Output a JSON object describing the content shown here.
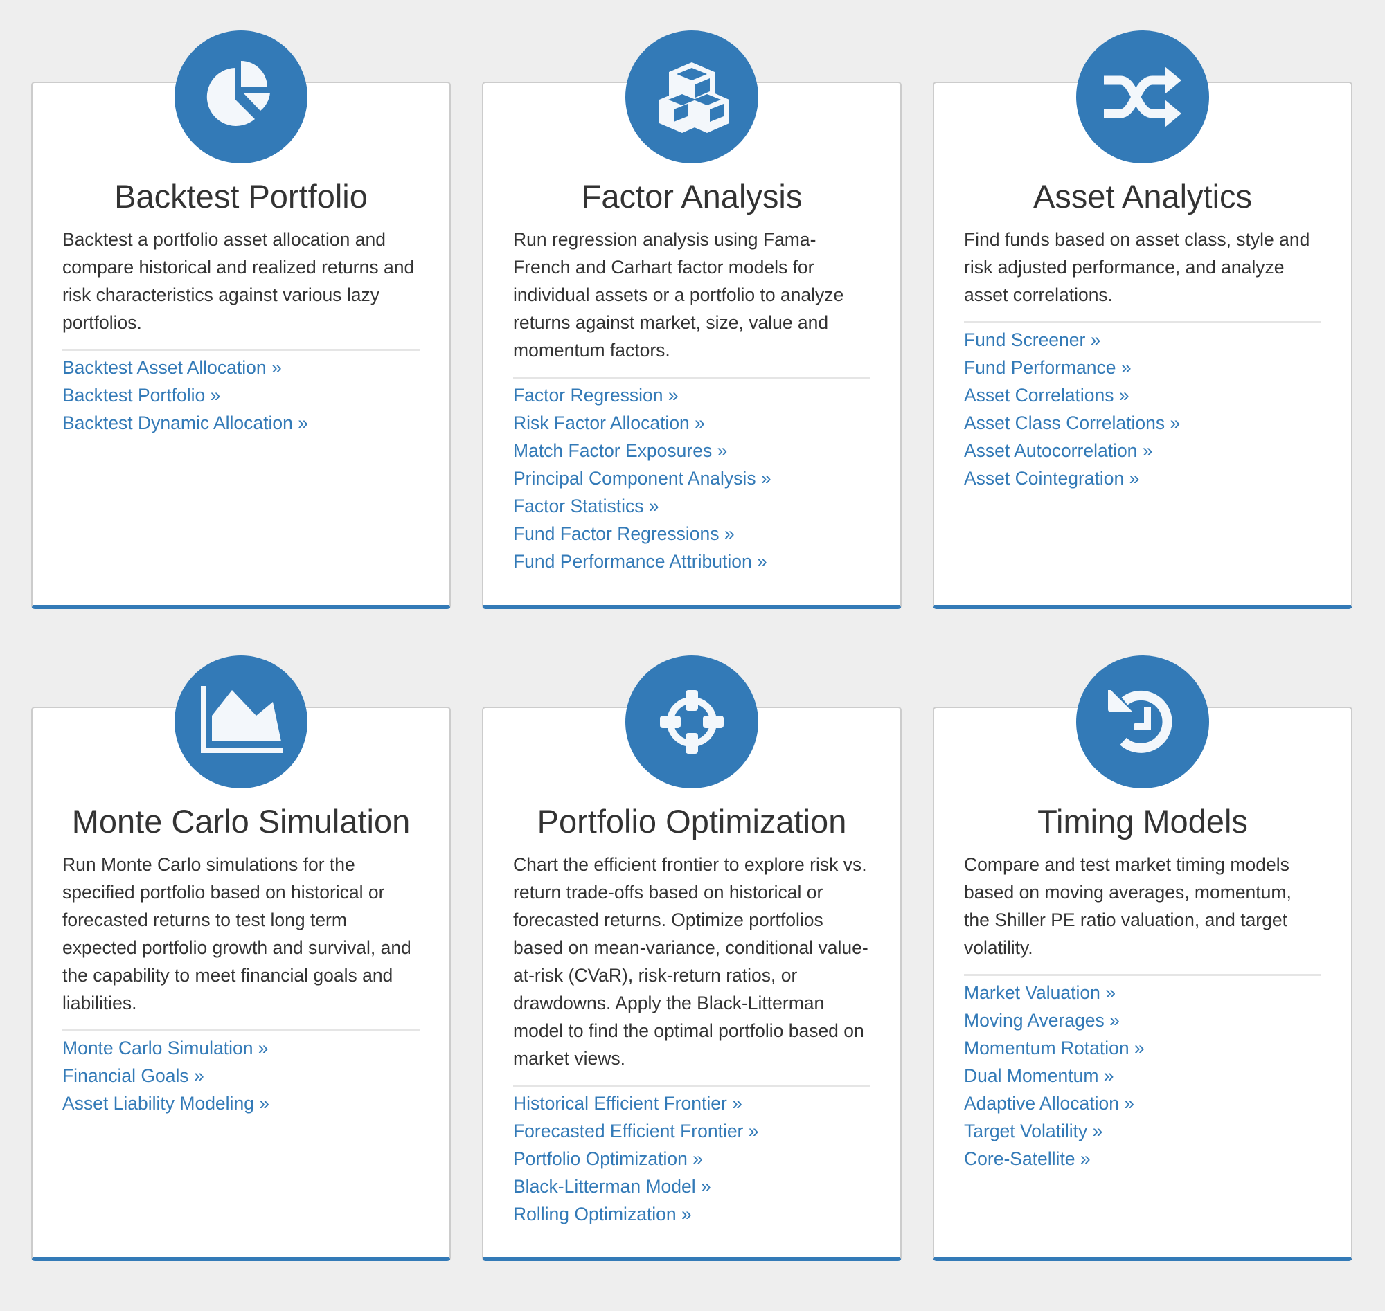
{
  "accent_color": "#337ab7",
  "link_suffix": " »",
  "cards": [
    {
      "icon": "pie-chart-icon",
      "title": "Backtest Portfolio",
      "description": "Backtest a portfolio asset allocation and compare historical and realized returns and risk characteristics against various lazy portfolios.",
      "links": [
        "Backtest Asset Allocation »",
        "Backtest Portfolio »",
        "Backtest Dynamic Allocation »"
      ]
    },
    {
      "icon": "cubes-icon",
      "title": "Factor Analysis",
      "description": "Run regression analysis using Fama-French and Carhart factor models for individual assets or a portfolio to analyze returns against market, size, value and momentum factors.",
      "links": [
        "Factor Regression »",
        "Risk Factor Allocation »",
        "Match Factor Exposures »",
        "Principal Component Analysis »",
        "Factor Statistics »",
        "Fund Factor Regressions »",
        "Fund Performance Attribution »"
      ]
    },
    {
      "icon": "shuffle-icon",
      "title": "Asset Analytics",
      "description": "Find funds based on asset class, style and risk adjusted performance, and analyze asset correlations.",
      "links": [
        "Fund Screener »",
        "Fund Performance »",
        "Asset Correlations »",
        "Asset Class Correlations »",
        "Asset Autocorrelation »",
        "Asset Cointegration »"
      ]
    },
    {
      "icon": "area-chart-icon",
      "title": "Monte Carlo Simulation",
      "description": "Run Monte Carlo simulations for the specified portfolio based on historical or forecasted returns to test long term expected portfolio growth and survival, and the capability to meet financial goals and liabilities.",
      "links": [
        "Monte Carlo Simulation »",
        "Financial Goals »",
        "Asset Liability Modeling »"
      ]
    },
    {
      "icon": "crosshairs-icon",
      "title": "Portfolio Optimization",
      "description": "Chart the efficient frontier to explore risk vs. return trade-offs based on historical or forecasted returns. Optimize portfolios based on mean-variance, conditional value-at-risk (CVaR), risk-return ratios, or drawdowns. Apply the Black-Litterman model to find the optimal portfolio based on market views.",
      "links": [
        "Historical Efficient Frontier »",
        "Forecasted Efficient Frontier »",
        "Portfolio Optimization »",
        "Black-Litterman Model »",
        "Rolling Optimization »"
      ]
    },
    {
      "icon": "history-icon",
      "title": "Timing Models",
      "description": "Compare and test market timing models based on moving averages, momentum, the Shiller PE ratio valuation, and target volatility.",
      "links": [
        "Market Valuation »",
        "Moving Averages »",
        "Momentum Rotation »",
        "Dual Momentum »",
        "Adaptive Allocation »",
        "Target Volatility »",
        "Core-Satellite »"
      ]
    }
  ]
}
